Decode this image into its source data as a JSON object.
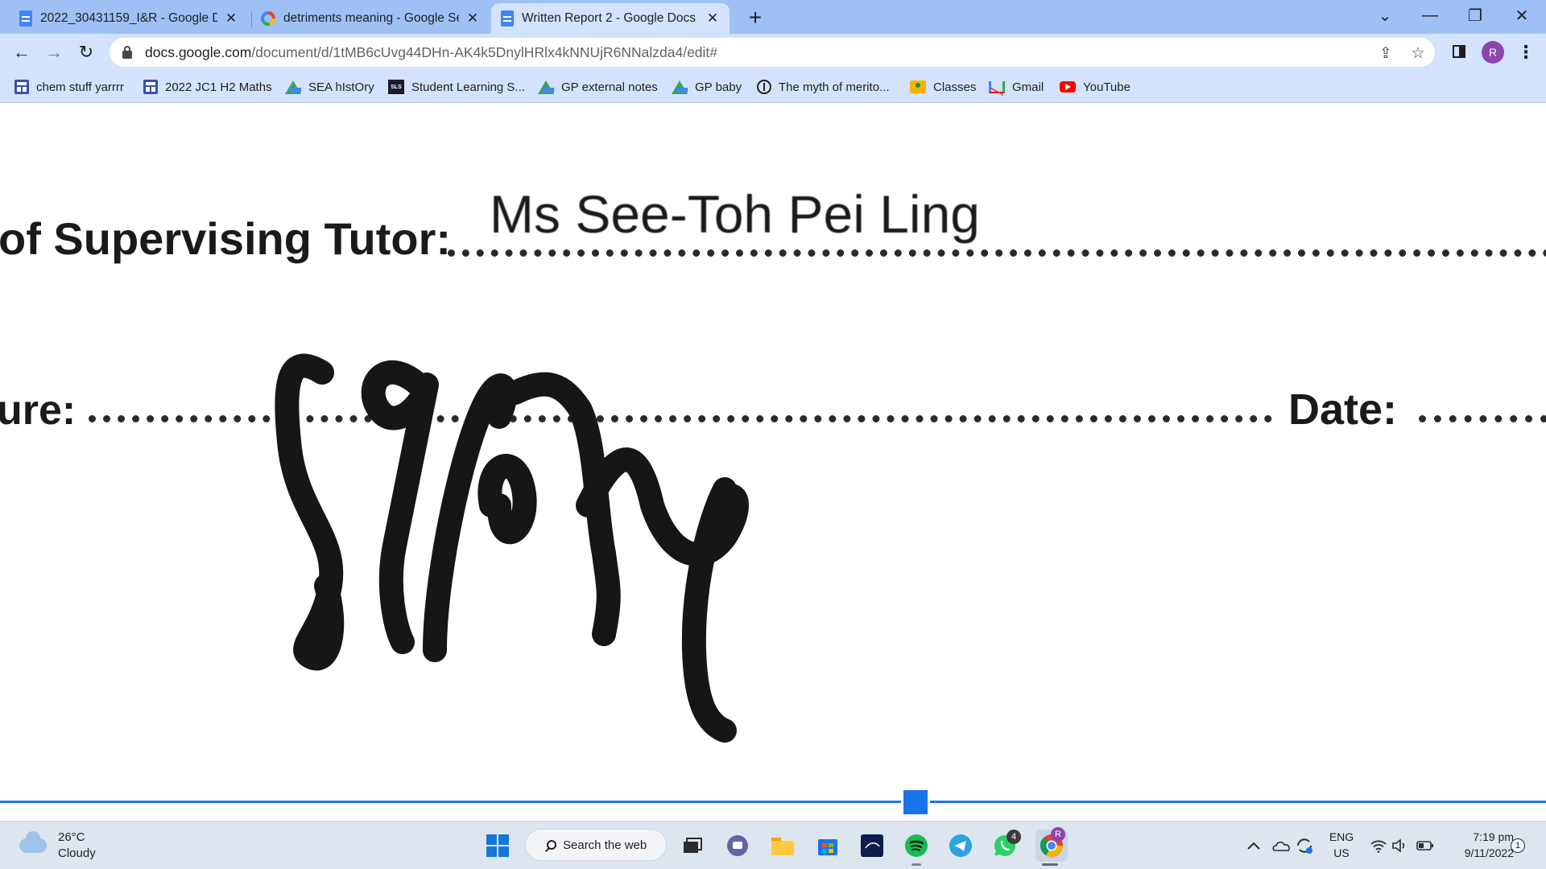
{
  "browser": {
    "tabs": [
      {
        "title": "2022_30431159_I&R - Google Docs",
        "favicon": "docs-icon",
        "active": false
      },
      {
        "title": "detriments meaning - Google Search",
        "favicon": "google-icon",
        "active": false
      },
      {
        "title": "Written Report 2 - Google Docs",
        "favicon": "docs-icon",
        "active": true
      }
    ],
    "new_tab_label": "+",
    "url_host": "docs.google.com",
    "url_path": "/document/d/1tMB6cUvg44DHn-AK4k5DnylHRlx4kNNUjR6NNalzda4/edit#",
    "profile_initial": "R",
    "bookmarks": [
      {
        "label": "chem stuff yarrrr",
        "icon": "sheet-icon"
      },
      {
        "label": "2022 JC1 H2 Maths",
        "icon": "sheet-icon"
      },
      {
        "label": "SEA hIstOry",
        "icon": "drive-icon"
      },
      {
        "label": "Student Learning S...",
        "icon": "sls-icon"
      },
      {
        "label": "GP external notes",
        "icon": "drive-icon"
      },
      {
        "label": "GP baby",
        "icon": "drive-icon"
      },
      {
        "label": "The myth of merito...",
        "icon": "circle-icon"
      },
      {
        "label": "Classes",
        "icon": "classroom-icon"
      },
      {
        "label": "Gmail",
        "icon": "gmail-icon"
      },
      {
        "label": "YouTube",
        "icon": "youtube-icon"
      }
    ],
    "sls_icon_text": "SLS"
  },
  "document": {
    "tutor_label": "of Supervising Tutor:",
    "tutor_name": "Ms See-Toh Pei Ling",
    "signature_label": "ure:",
    "date_label": "Date:",
    "signature": "handwritten signature"
  },
  "taskbar": {
    "weather_temp": "26°C",
    "weather_desc": "Cloudy",
    "search_label": "Search the web",
    "whatsapp_badge": "4",
    "chrome_badge": "R",
    "lang_line1": "ENG",
    "lang_line2": "US",
    "time": "7:19 pm",
    "date": "9/11/2022",
    "notification_count": "1"
  },
  "colors": {
    "tabstrip": "#9ec0f4",
    "toolbar": "#d3e3fd",
    "accent": "#1a73e8",
    "taskbar": "#dde6ef"
  }
}
